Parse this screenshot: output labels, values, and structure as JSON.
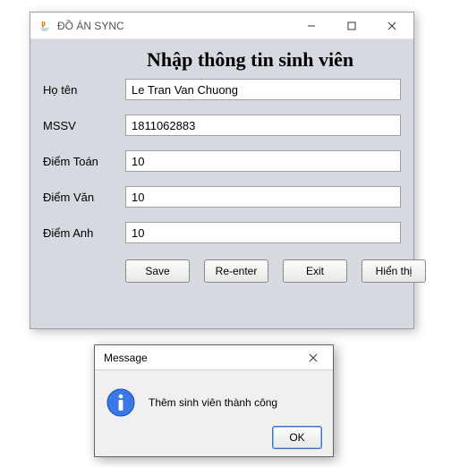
{
  "window": {
    "title": "ĐỒ ÁN SYNC",
    "heading": "Nhập thông tin sinh viên"
  },
  "form": {
    "hoten": {
      "label": "Họ tên",
      "value": "Le Tran Van Chuong"
    },
    "mssv": {
      "label": "MSSV",
      "value": "1811062883"
    },
    "toan": {
      "label": "Điểm Toán",
      "value": "10"
    },
    "van": {
      "label": "Điểm Văn",
      "value": "10"
    },
    "anh": {
      "label": "Điểm Anh",
      "value": "10"
    }
  },
  "buttons": {
    "save": "Save",
    "reenter": "Re-enter",
    "exit": "Exit",
    "show": "Hiển thị"
  },
  "dialog": {
    "title": "Message",
    "message": "Thêm sinh viên thành công",
    "ok": "OK"
  }
}
